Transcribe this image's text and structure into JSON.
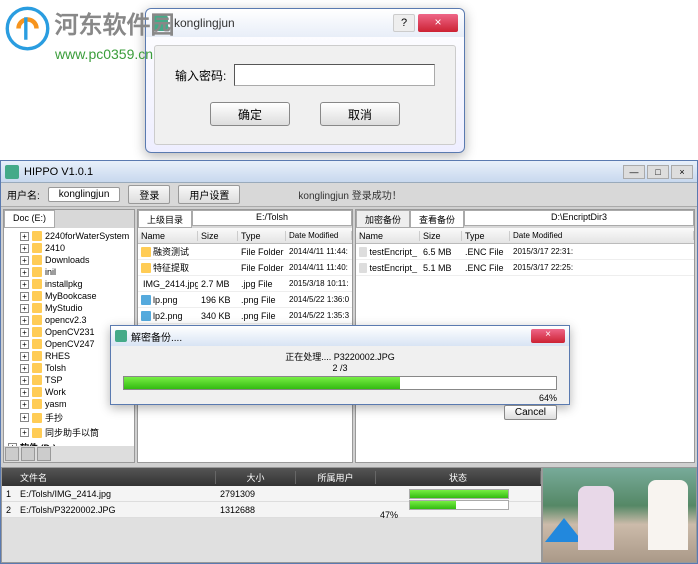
{
  "watermark": {
    "text1": "河东软件园",
    "text2": "www.pc0359.cn"
  },
  "passwordDialog": {
    "title": "konglingjun",
    "help": "?",
    "close": "×",
    "label": "输入密码:",
    "ok": "确定",
    "cancel": "取消"
  },
  "app": {
    "title": "HIPPO  V1.0.1",
    "winMin": "—",
    "winMax": "□",
    "winClose": "×",
    "toolbar": {
      "userLabel": "用户名:",
      "user": "konglingjun",
      "login": "登录",
      "settings": "用户设置",
      "status": "konglingjun 登录成功！"
    }
  },
  "tree": {
    "tab": "Doc (E:)",
    "nodes": [
      "2240forWaterSystem",
      "2410",
      "Downloads",
      "inil",
      "installpkg",
      "MyBookcase",
      "MyStudio",
      "opencv2.3",
      "OpenCV231",
      "OpenCV247",
      "RHES",
      "Tolsh",
      "TSP",
      "Work",
      "yasm",
      "手抄",
      "同步助手以筒"
    ],
    "subnode": "软件 (D:)"
  },
  "files": {
    "tab1": "上级目录",
    "path": "E:/Tolsh",
    "cols": {
      "c1": "Name",
      "c2": "Size",
      "c3": "Type",
      "c4": "Date Modified"
    },
    "rows": [
      {
        "name": "融资测试",
        "size": "",
        "type": "File Folder",
        "date": "2014/4/11 11:44:",
        "icon": "folder"
      },
      {
        "name": "特征提取",
        "size": "",
        "type": "File Folder",
        "date": "2014/4/11 11:40:",
        "icon": "folder"
      },
      {
        "name": "IMG_2414.jpg",
        "size": "2.7 MB",
        "type": ".jpg File",
        "date": "2015/3/18 10:11:",
        "icon": "img"
      },
      {
        "name": "lp.png",
        "size": "196 KB",
        "type": ".png File",
        "date": "2014/5/22 1:36:0",
        "icon": "img"
      },
      {
        "name": "lp2.png",
        "size": "340 KB",
        "type": ".png File",
        "date": "2014/5/22 1:35:3",
        "icon": "img"
      }
    ]
  },
  "enc": {
    "tab1": "加密备份",
    "tab2": "查看备份",
    "path": "D:\\EncriptDir3",
    "cols": {
      "c1": "Name",
      "c2": "Size",
      "c3": "Type",
      "c4": "Date Modified"
    },
    "rows": [
      {
        "name": "testEncript_",
        "size": "6.5 MB",
        "type": ".ENC File",
        "date": "2015/3/17 22:31:"
      },
      {
        "name": "testEncript_",
        "size": "5.1 MB",
        "type": ".ENC File",
        "date": "2015/3/17 22:25:"
      }
    ]
  },
  "progress": {
    "title": "解密备份....",
    "line1": "正在处理.... P3220002.JPG",
    "line2": "2  /3",
    "percent": 64,
    "percentText": "64%",
    "cancel": "Cancel"
  },
  "tasks": {
    "cols": {
      "c1": "文件名",
      "c2": "大小",
      "c3": "所属用户",
      "c4": "状态"
    },
    "rows": [
      {
        "name": "E:/Tolsh/IMG_2414.jpg",
        "size": "2791309",
        "user": "",
        "prog": 100,
        "pct": ""
      },
      {
        "name": "E:/Tolsh/P3220002.JPG",
        "size": "1312688",
        "user": "",
        "prog": 47,
        "pct": "47%"
      }
    ]
  }
}
